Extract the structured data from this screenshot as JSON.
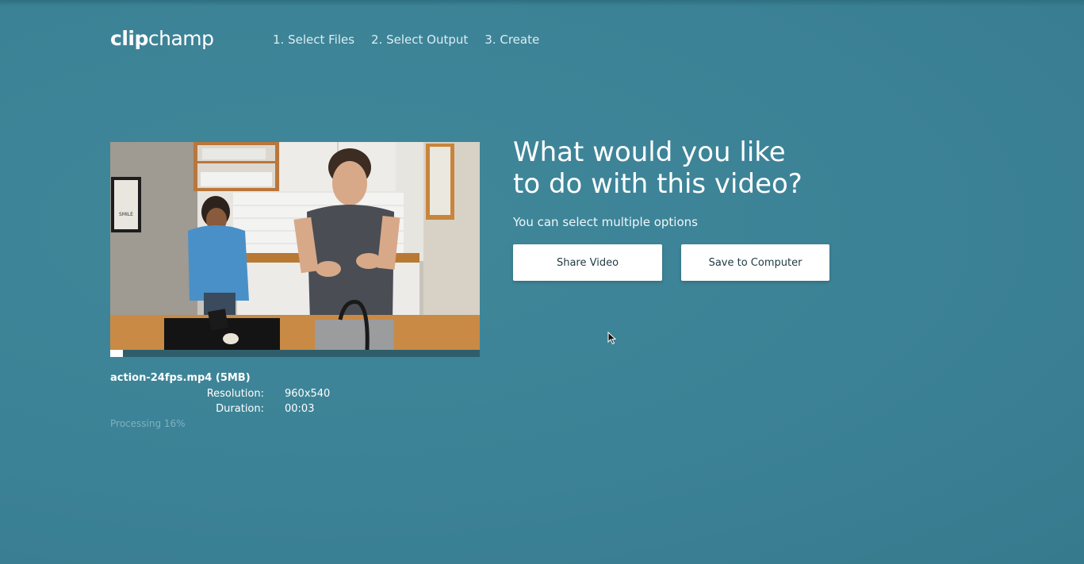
{
  "header": {
    "logo_clip": "clip",
    "logo_champ": "champ",
    "steps": [
      {
        "label": "1. Select Files"
      },
      {
        "label": "2. Select Output"
      },
      {
        "label": "3. Create"
      }
    ]
  },
  "video": {
    "file_name": "action-24fps.mp4 (5MB)",
    "resolution_label": "Resolution:",
    "resolution_value": "960x540",
    "duration_label": "Duration:",
    "duration_value": "00:03",
    "processing_text": "Processing 16%",
    "playback_progress": 0.035,
    "frame_sign_text": "SMILE"
  },
  "prompt": {
    "title_line1": "What would you like",
    "title_line2": "to do with this video?",
    "subtitle": "You can select multiple options",
    "share_label": "Share Video",
    "save_label": "Save to Computer"
  },
  "colors": {
    "background": "#3d8396",
    "button_bg": "#ffffff",
    "button_text": "#1f3a44",
    "processing_text": "#7fb1c0"
  }
}
